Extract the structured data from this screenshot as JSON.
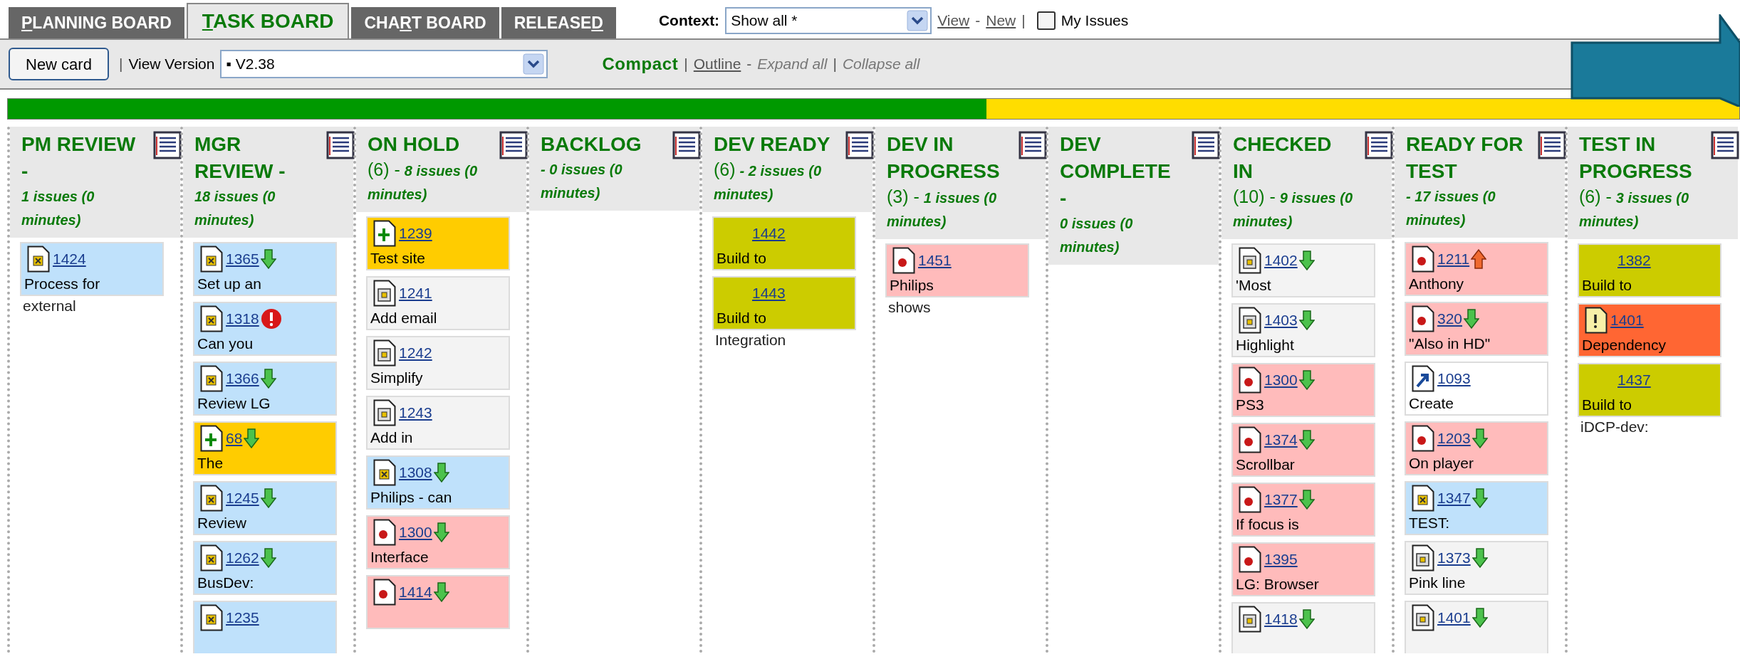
{
  "tabs": [
    {
      "key": "P",
      "after": "LANNING BOARD",
      "selected": false
    },
    {
      "key": "T",
      "after": "ASK BOARD",
      "selected": true
    },
    {
      "before": "CHA",
      "key": "R",
      "after": "T BOARD",
      "selected": false
    },
    {
      "before": "RELEASE",
      "key": "D",
      "selected": false
    }
  ],
  "context": {
    "label": "Context:",
    "value": "Show all *",
    "links": [
      "View",
      "New"
    ],
    "separators": [
      "-",
      "|"
    ],
    "my_issues": {
      "label": "My Issues",
      "checked": false
    }
  },
  "toolbar": {
    "new_card": "New card",
    "separator": "|",
    "version_label": "View Version",
    "version_value": "▪ V2.38",
    "views": [
      {
        "label": "Compact",
        "selected": true
      },
      {
        "label": "Outline",
        "selected": false
      }
    ],
    "view_separators": [
      "|",
      "-",
      "|"
    ],
    "expand_all": "Expand all",
    "collapse_all": "Collapse all"
  },
  "progress": {
    "level": 0.565
  },
  "columns": [
    {
      "title": "PM REVIEW -",
      "subtitle": "1 issues (0 minutes)",
      "cards": [
        {
          "id": "1424",
          "kind": "feature",
          "color": "#bfe1fb",
          "lines": [
            "Process for",
            "external"
          ]
        }
      ]
    },
    {
      "title": "MGR REVIEW -",
      "subtitle": "18 issues (0 minutes)",
      "cards": [
        {
          "id": "1365",
          "kind": "feature",
          "color": "#bfe1fb",
          "down": true,
          "lines": [
            "Set up an"
          ]
        },
        {
          "id": "1318",
          "kind": "feature",
          "color": "#bfe1fb",
          "alert": true,
          "lines": [
            "Can you"
          ]
        },
        {
          "id": "1366",
          "kind": "feature",
          "color": "#bfe1fb",
          "down": true,
          "lines": [
            "Review LG"
          ]
        },
        {
          "id": "68",
          "kind": "new",
          "color": "#ffcc00",
          "down": true,
          "lines": [
            "The"
          ]
        },
        {
          "id": "1245",
          "kind": "feature",
          "color": "#bfe1fb",
          "down": true,
          "lines": [
            "Review"
          ]
        },
        {
          "id": "1262",
          "kind": "feature",
          "color": "#bfe1fb",
          "down": true,
          "lines": [
            "BusDev:"
          ]
        },
        {
          "id": "1235",
          "kind": "feature",
          "color": "#bfe1fb"
        }
      ]
    },
    {
      "title": "ON HOLD",
      "count": "(6) -",
      "subtitle": "8 issues (0 minutes)",
      "cards": [
        {
          "id": "1239",
          "kind": "new",
          "color": "#ffcc00",
          "lines": [
            "Test site"
          ]
        },
        {
          "id": "1241",
          "kind": "doc",
          "color": "#f3f3f3",
          "lines": [
            "Add email"
          ]
        },
        {
          "id": "1242",
          "kind": "doc",
          "color": "#f3f3f3",
          "lines": [
            "Simplify"
          ]
        },
        {
          "id": "1243",
          "kind": "doc",
          "color": "#f3f3f3",
          "lines": [
            "Add in"
          ]
        },
        {
          "id": "1308",
          "kind": "feature",
          "color": "#bfe1fb",
          "down": true,
          "lines": [
            "Philips - can"
          ]
        },
        {
          "id": "1300",
          "kind": "bug",
          "color": "#ffbbbb",
          "down": true,
          "lines": [
            "Interface"
          ]
        },
        {
          "id": "1414",
          "kind": "bug",
          "color": "#ffbbbb",
          "down": true
        }
      ]
    },
    {
      "title": "BACKLOG",
      "subtitle": "- 0 issues (0 minutes)"
    },
    {
      "title": "DEV READY",
      "count": "(6)",
      "subtitle": "- 2 issues (0 minutes)",
      "cards": [
        {
          "id": "1442",
          "kind": "build",
          "color": "#cccc00",
          "lines": [
            "Build to"
          ]
        },
        {
          "id": "1443",
          "kind": "build",
          "color": "#cccc00",
          "lines": [
            "Build to",
            "Integration"
          ]
        }
      ]
    },
    {
      "title": "DEV IN PROGRESS",
      "count": "(3) -",
      "subtitle": "1 issues (0 minutes)",
      "cards": [
        {
          "id": "1451",
          "kind": "bug",
          "color": "#ffbbbb",
          "lines": [
            "Philips",
            "shows"
          ]
        }
      ]
    },
    {
      "title": "DEV COMPLETE -",
      "subtitle": "0 issues (0 minutes)"
    },
    {
      "title": "CHECKED IN",
      "count": "(10) -",
      "subtitle": "9 issues (0 minutes)",
      "cards": [
        {
          "id": "1402",
          "kind": "doc",
          "color": "#f3f3f3",
          "down": true,
          "lines": [
            "'Most"
          ]
        },
        {
          "id": "1403",
          "kind": "doc",
          "color": "#f3f3f3",
          "down": true,
          "lines": [
            "Highlight"
          ]
        },
        {
          "id": "1300",
          "kind": "bug",
          "color": "#ffbbbb",
          "down": true,
          "lines": [
            "PS3"
          ]
        },
        {
          "id": "1374",
          "kind": "bug",
          "color": "#ffbbbb",
          "down": true,
          "lines": [
            "Scrollbar"
          ]
        },
        {
          "id": "1377",
          "kind": "bug",
          "color": "#ffbbbb",
          "down": true,
          "lines": [
            "If focus is"
          ]
        },
        {
          "id": "1395",
          "kind": "bug",
          "color": "#ffbbbb",
          "lines": [
            "LG: Browser"
          ]
        },
        {
          "id": "1418",
          "kind": "doc",
          "color": "#f3f3f3",
          "down": true
        }
      ]
    },
    {
      "title": "READY FOR TEST",
      "subtitle": "- 17 issues (0 minutes)",
      "cards": [
        {
          "id": "1211",
          "kind": "bug",
          "color": "#ffbbbb",
          "up": true,
          "lines": [
            "Anthony"
          ]
        },
        {
          "id": "320",
          "kind": "bug",
          "color": "#ffbbbb",
          "down": true,
          "lines": [
            "\"Also in HD\""
          ]
        },
        {
          "id": "1093",
          "kind": "link",
          "color": "#ffffff",
          "lines": [
            "Create"
          ]
        },
        {
          "id": "1203",
          "kind": "bug",
          "color": "#ffbbbb",
          "down": true,
          "lines": [
            "On player"
          ]
        },
        {
          "id": "1347",
          "kind": "feature",
          "color": "#bfe1fb",
          "down": true,
          "lines": [
            "TEST:"
          ]
        },
        {
          "id": "1373",
          "kind": "doc",
          "color": "#f3f3f3",
          "down": true,
          "lines": [
            "Pink line"
          ]
        },
        {
          "id": "1401",
          "kind": "doc",
          "color": "#f3f3f3",
          "down": true
        }
      ]
    },
    {
      "title": "TEST IN PROGRESS",
      "count": "(6) -",
      "subtitle": "3 issues (0 minutes)",
      "cards": [
        {
          "id": "1382",
          "kind": "build",
          "color": "#cccc00",
          "lines": [
            "Build to"
          ]
        },
        {
          "id": "1401",
          "kind": "warning",
          "color": "#ff6633",
          "lines": [
            "Dependency"
          ]
        },
        {
          "id": "1437",
          "kind": "build",
          "color": "#cccc00",
          "lines": [
            "Build to",
            "iDCP-dev:"
          ]
        }
      ]
    }
  ]
}
